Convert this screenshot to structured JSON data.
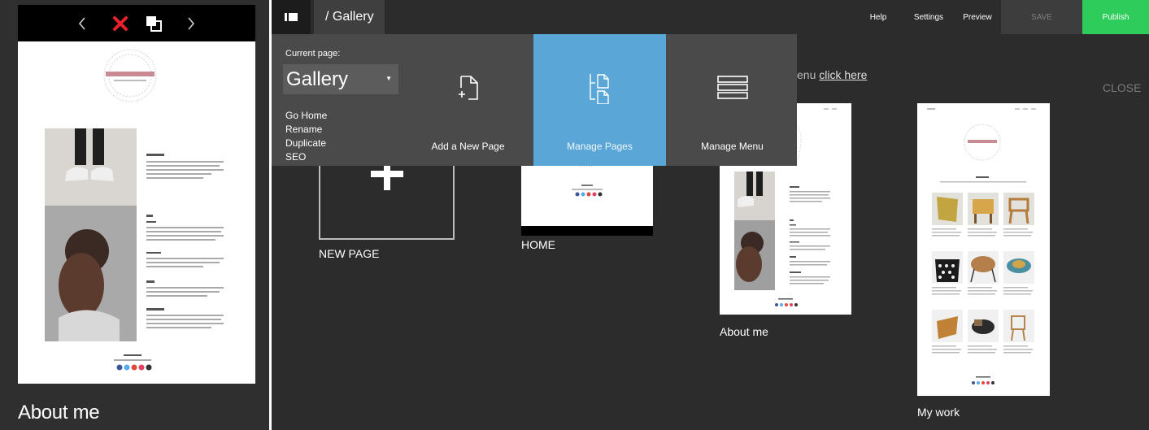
{
  "preview": {
    "nav": {
      "prev_icon": "chevron-left-icon",
      "close_icon": "close-x-icon",
      "duplicate_icon": "duplicate-pages-icon",
      "next_icon": "chevron-right-icon"
    },
    "caption": "About me"
  },
  "topbar": {
    "page_tab": "/ Gallery",
    "help": "Help",
    "settings": "Settings",
    "preview": "Preview",
    "save": "SAVE",
    "publish": "Publish"
  },
  "dropdown": {
    "current_page_label": "Current page:",
    "current_page_value": "Gallery",
    "actions": [
      "Go Home",
      "Rename",
      "Duplicate",
      "SEO"
    ],
    "tiles": {
      "add": "Add a New Page",
      "manage_pages": "Manage Pages",
      "manage_menu": "Manage Menu"
    }
  },
  "manager": {
    "hint_text": "enu",
    "hint_link": "click here",
    "close": "CLOSE",
    "pages": [
      {
        "label": "NEW PAGE"
      },
      {
        "label": "HOME"
      },
      {
        "label": "About me"
      },
      {
        "label": "My work"
      }
    ]
  },
  "colors": {
    "publish": "#2ecc5a",
    "manage_pages_tile": "#5aa6d6",
    "close_x": "#e8212c"
  }
}
